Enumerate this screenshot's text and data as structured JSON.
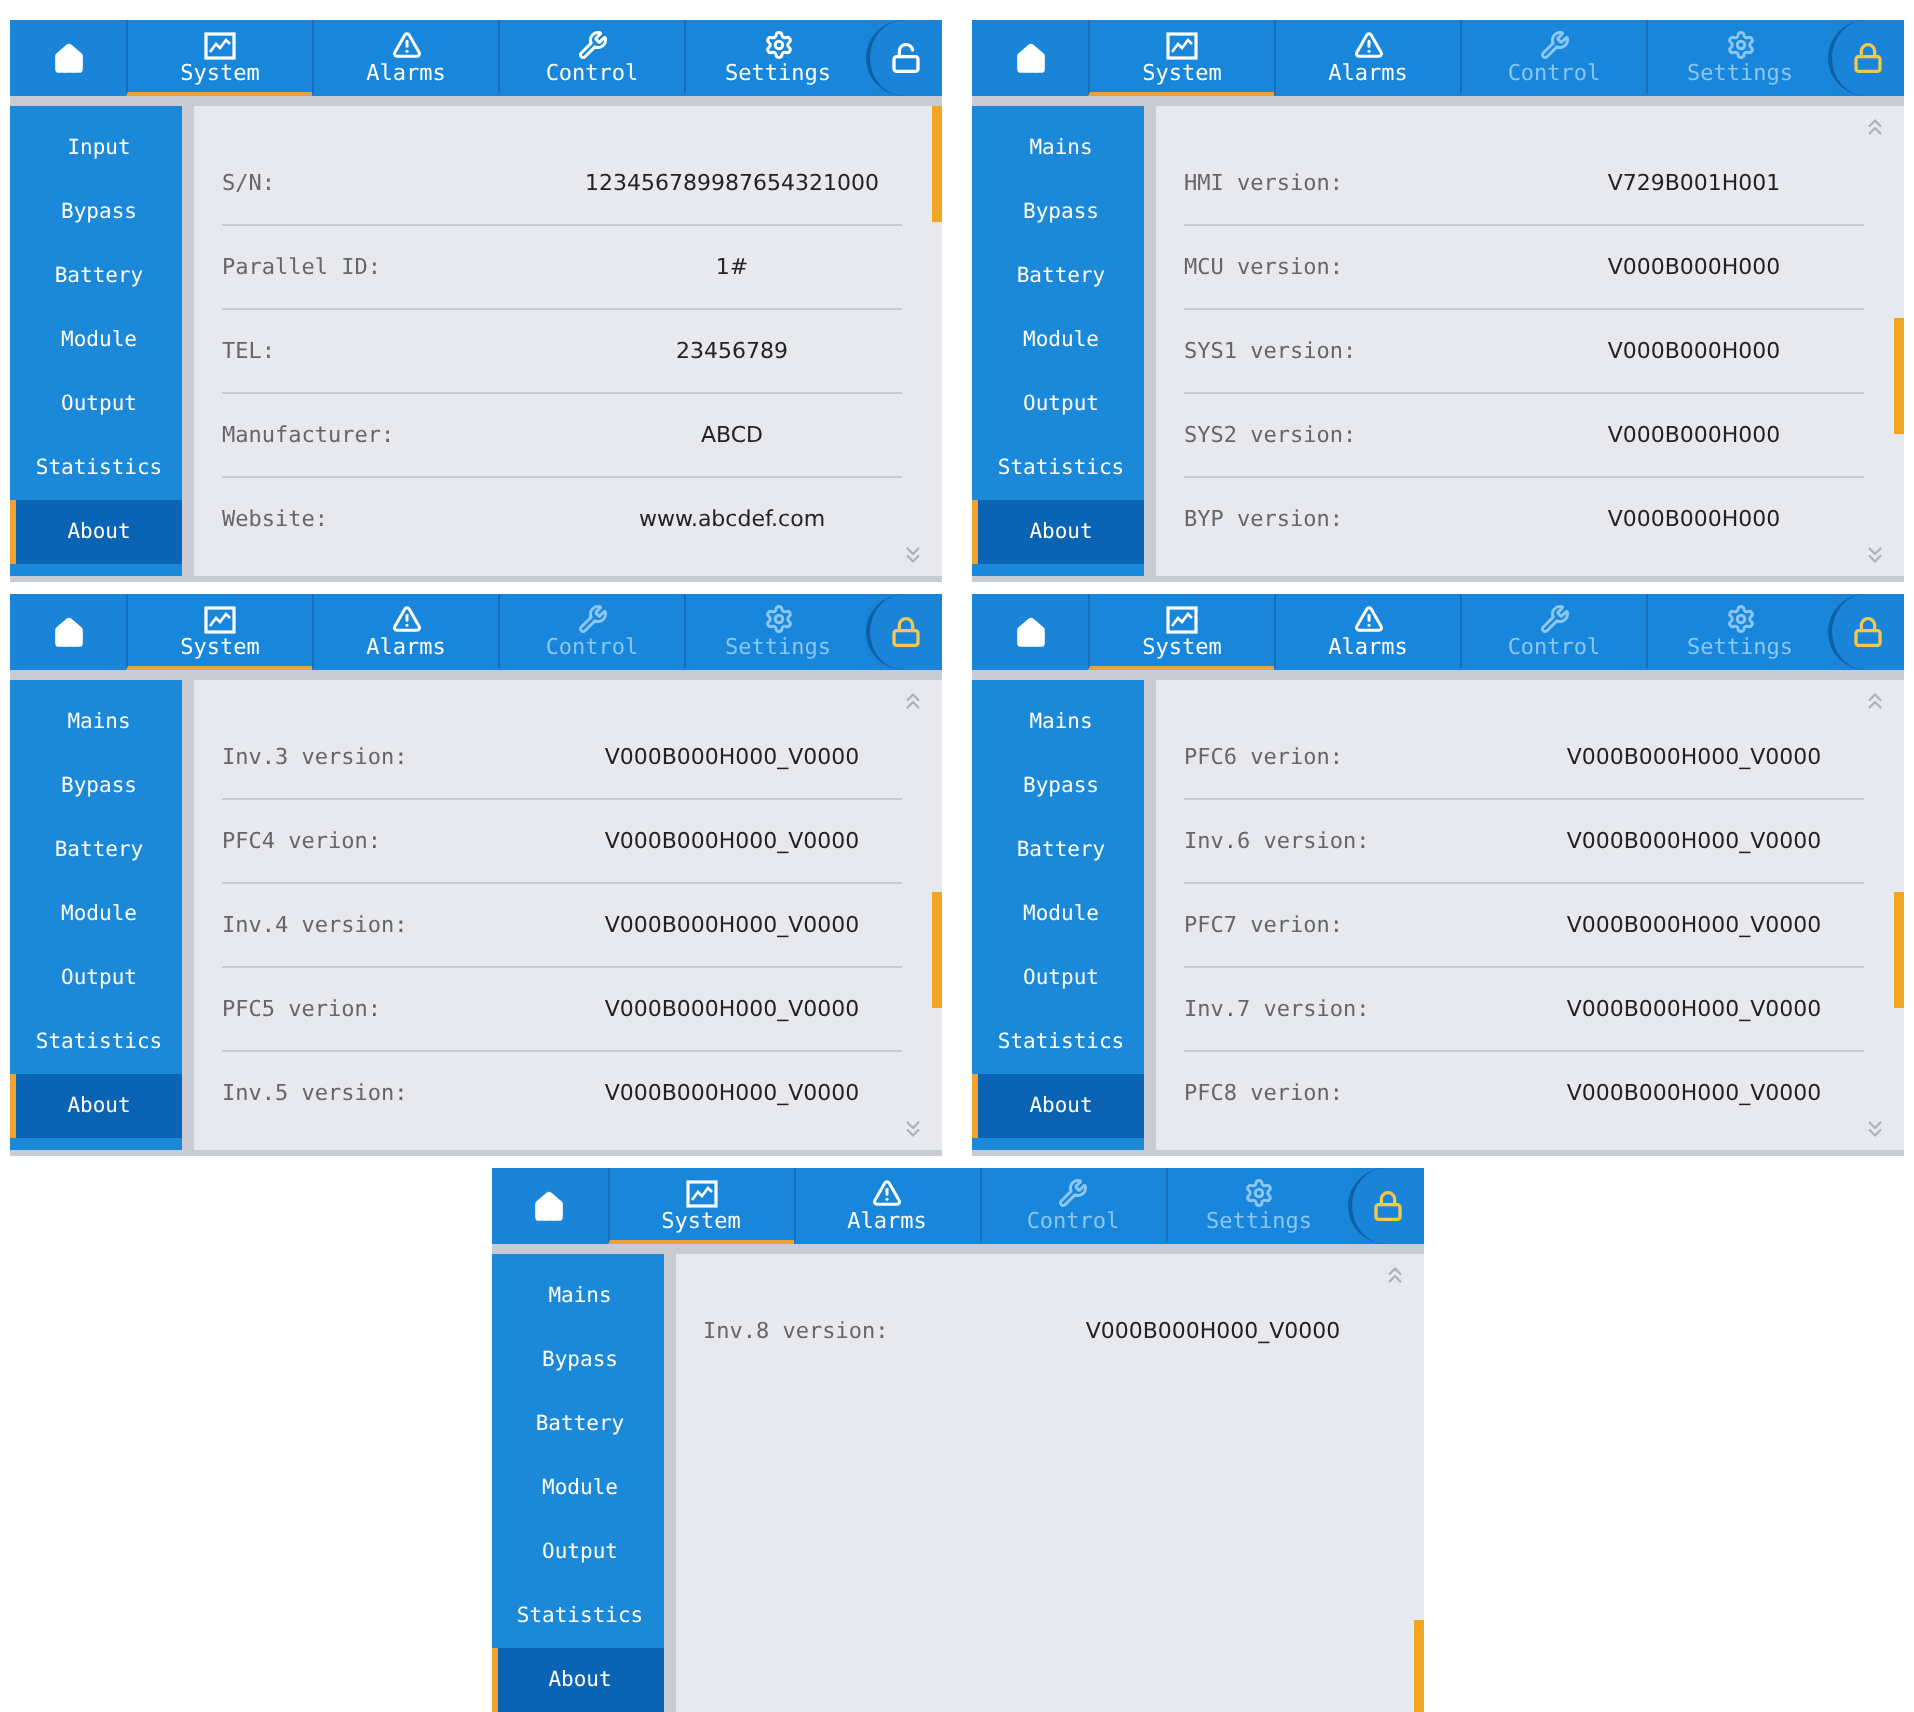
{
  "screens": [
    {
      "locked": false,
      "scroll_up": false,
      "scroll_down": true,
      "tabs": [
        {
          "kind": "home",
          "selected": false,
          "disabled": false
        },
        {
          "kind": "system",
          "label": "System",
          "selected": true,
          "disabled": false
        },
        {
          "kind": "alarms",
          "label": "Alarms",
          "selected": false,
          "disabled": false
        },
        {
          "kind": "control",
          "label": "Control",
          "selected": false,
          "disabled": false
        },
        {
          "kind": "settings",
          "label": "Settings",
          "selected": false,
          "disabled": false
        }
      ],
      "sidebar": [
        {
          "label": "Input",
          "selected": false
        },
        {
          "label": "Bypass",
          "selected": false
        },
        {
          "label": "Battery",
          "selected": false
        },
        {
          "label": "Module",
          "selected": false
        },
        {
          "label": "Output",
          "selected": false
        },
        {
          "label": "Statistics",
          "selected": false
        },
        {
          "label": "About",
          "selected": true
        }
      ],
      "rows": [
        {
          "label": "S/N:",
          "value": "123456789987654321000"
        },
        {
          "label": "Parallel ID:",
          "value": "1#"
        },
        {
          "label": "TEL:",
          "value": "23456789"
        },
        {
          "label": "Manufacturer:",
          "value": "ABCD"
        },
        {
          "label": "Website:",
          "value": "www.abcdef.com"
        }
      ]
    },
    {
      "locked": true,
      "scroll_up": true,
      "scroll_down": true,
      "tabs": [
        {
          "kind": "home",
          "selected": false,
          "disabled": false
        },
        {
          "kind": "system",
          "label": "System",
          "selected": true,
          "disabled": false
        },
        {
          "kind": "alarms",
          "label": "Alarms",
          "selected": false,
          "disabled": false
        },
        {
          "kind": "control",
          "label": "Control",
          "selected": false,
          "disabled": true
        },
        {
          "kind": "settings",
          "label": "Settings",
          "selected": false,
          "disabled": true
        }
      ],
      "sidebar": [
        {
          "label": "Mains",
          "selected": false
        },
        {
          "label": "Bypass",
          "selected": false
        },
        {
          "label": "Battery",
          "selected": false
        },
        {
          "label": "Module",
          "selected": false
        },
        {
          "label": "Output",
          "selected": false
        },
        {
          "label": "Statistics",
          "selected": false
        },
        {
          "label": "About",
          "selected": true
        }
      ],
      "rows": [
        {
          "label": "HMI version:",
          "value": "V729B001H001"
        },
        {
          "label": "MCU version:",
          "value": "V000B000H000"
        },
        {
          "label": "SYS1 version:",
          "value": "V000B000H000"
        },
        {
          "label": "SYS2 version:",
          "value": "V000B000H000"
        },
        {
          "label": "BYP version:",
          "value": "V000B000H000"
        }
      ]
    },
    {
      "locked": true,
      "scroll_up": true,
      "scroll_down": true,
      "tabs": [
        {
          "kind": "home",
          "selected": false,
          "disabled": false
        },
        {
          "kind": "system",
          "label": "System",
          "selected": true,
          "disabled": false
        },
        {
          "kind": "alarms",
          "label": "Alarms",
          "selected": false,
          "disabled": false
        },
        {
          "kind": "control",
          "label": "Control",
          "selected": false,
          "disabled": true
        },
        {
          "kind": "settings",
          "label": "Settings",
          "selected": false,
          "disabled": true
        }
      ],
      "sidebar": [
        {
          "label": "Mains",
          "selected": false
        },
        {
          "label": "Bypass",
          "selected": false
        },
        {
          "label": "Battery",
          "selected": false
        },
        {
          "label": "Module",
          "selected": false
        },
        {
          "label": "Output",
          "selected": false
        },
        {
          "label": "Statistics",
          "selected": false
        },
        {
          "label": "About",
          "selected": true
        }
      ],
      "rows": [
        {
          "label": "Inv.3 version:",
          "value": "V000B000H000_V0000"
        },
        {
          "label": "PFC4 verion:",
          "value": "V000B000H000_V0000"
        },
        {
          "label": "Inv.4 version:",
          "value": "V000B000H000_V0000"
        },
        {
          "label": "PFC5 verion:",
          "value": "V000B000H000_V0000"
        },
        {
          "label": "Inv.5 version:",
          "value": "V000B000H000_V0000"
        }
      ]
    },
    {
      "locked": true,
      "scroll_up": true,
      "scroll_down": true,
      "tabs": [
        {
          "kind": "home",
          "selected": false,
          "disabled": false
        },
        {
          "kind": "system",
          "label": "System",
          "selected": true,
          "disabled": false
        },
        {
          "kind": "alarms",
          "label": "Alarms",
          "selected": false,
          "disabled": false
        },
        {
          "kind": "control",
          "label": "Control",
          "selected": false,
          "disabled": true
        },
        {
          "kind": "settings",
          "label": "Settings",
          "selected": false,
          "disabled": true
        }
      ],
      "sidebar": [
        {
          "label": "Mains",
          "selected": false
        },
        {
          "label": "Bypass",
          "selected": false
        },
        {
          "label": "Battery",
          "selected": false
        },
        {
          "label": "Module",
          "selected": false
        },
        {
          "label": "Output",
          "selected": false
        },
        {
          "label": "Statistics",
          "selected": false
        },
        {
          "label": "About",
          "selected": true
        }
      ],
      "rows": [
        {
          "label": "PFC6 verion:",
          "value": "V000B000H000_V0000"
        },
        {
          "label": "Inv.6 version:",
          "value": "V000B000H000_V0000"
        },
        {
          "label": "PFC7 verion:",
          "value": "V000B000H000_V0000"
        },
        {
          "label": "Inv.7 version:",
          "value": "V000B000H000_V0000"
        },
        {
          "label": "PFC8 verion:",
          "value": "V000B000H000_V0000"
        }
      ]
    },
    {
      "locked": true,
      "scroll_up": true,
      "scroll_down": false,
      "tabs": [
        {
          "kind": "home",
          "selected": false,
          "disabled": false
        },
        {
          "kind": "system",
          "label": "System",
          "selected": true,
          "disabled": false
        },
        {
          "kind": "alarms",
          "label": "Alarms",
          "selected": false,
          "disabled": false
        },
        {
          "kind": "control",
          "label": "Control",
          "selected": false,
          "disabled": true
        },
        {
          "kind": "settings",
          "label": "Settings",
          "selected": false,
          "disabled": true
        }
      ],
      "sidebar": [
        {
          "label": "Mains",
          "selected": false
        },
        {
          "label": "Bypass",
          "selected": false
        },
        {
          "label": "Battery",
          "selected": false
        },
        {
          "label": "Module",
          "selected": false
        },
        {
          "label": "Output",
          "selected": false
        },
        {
          "label": "Statistics",
          "selected": false
        },
        {
          "label": "About",
          "selected": true
        }
      ],
      "rows": [
        {
          "label": "Inv.8 version:",
          "value": "V000B000H000_V0000"
        }
      ]
    }
  ]
}
